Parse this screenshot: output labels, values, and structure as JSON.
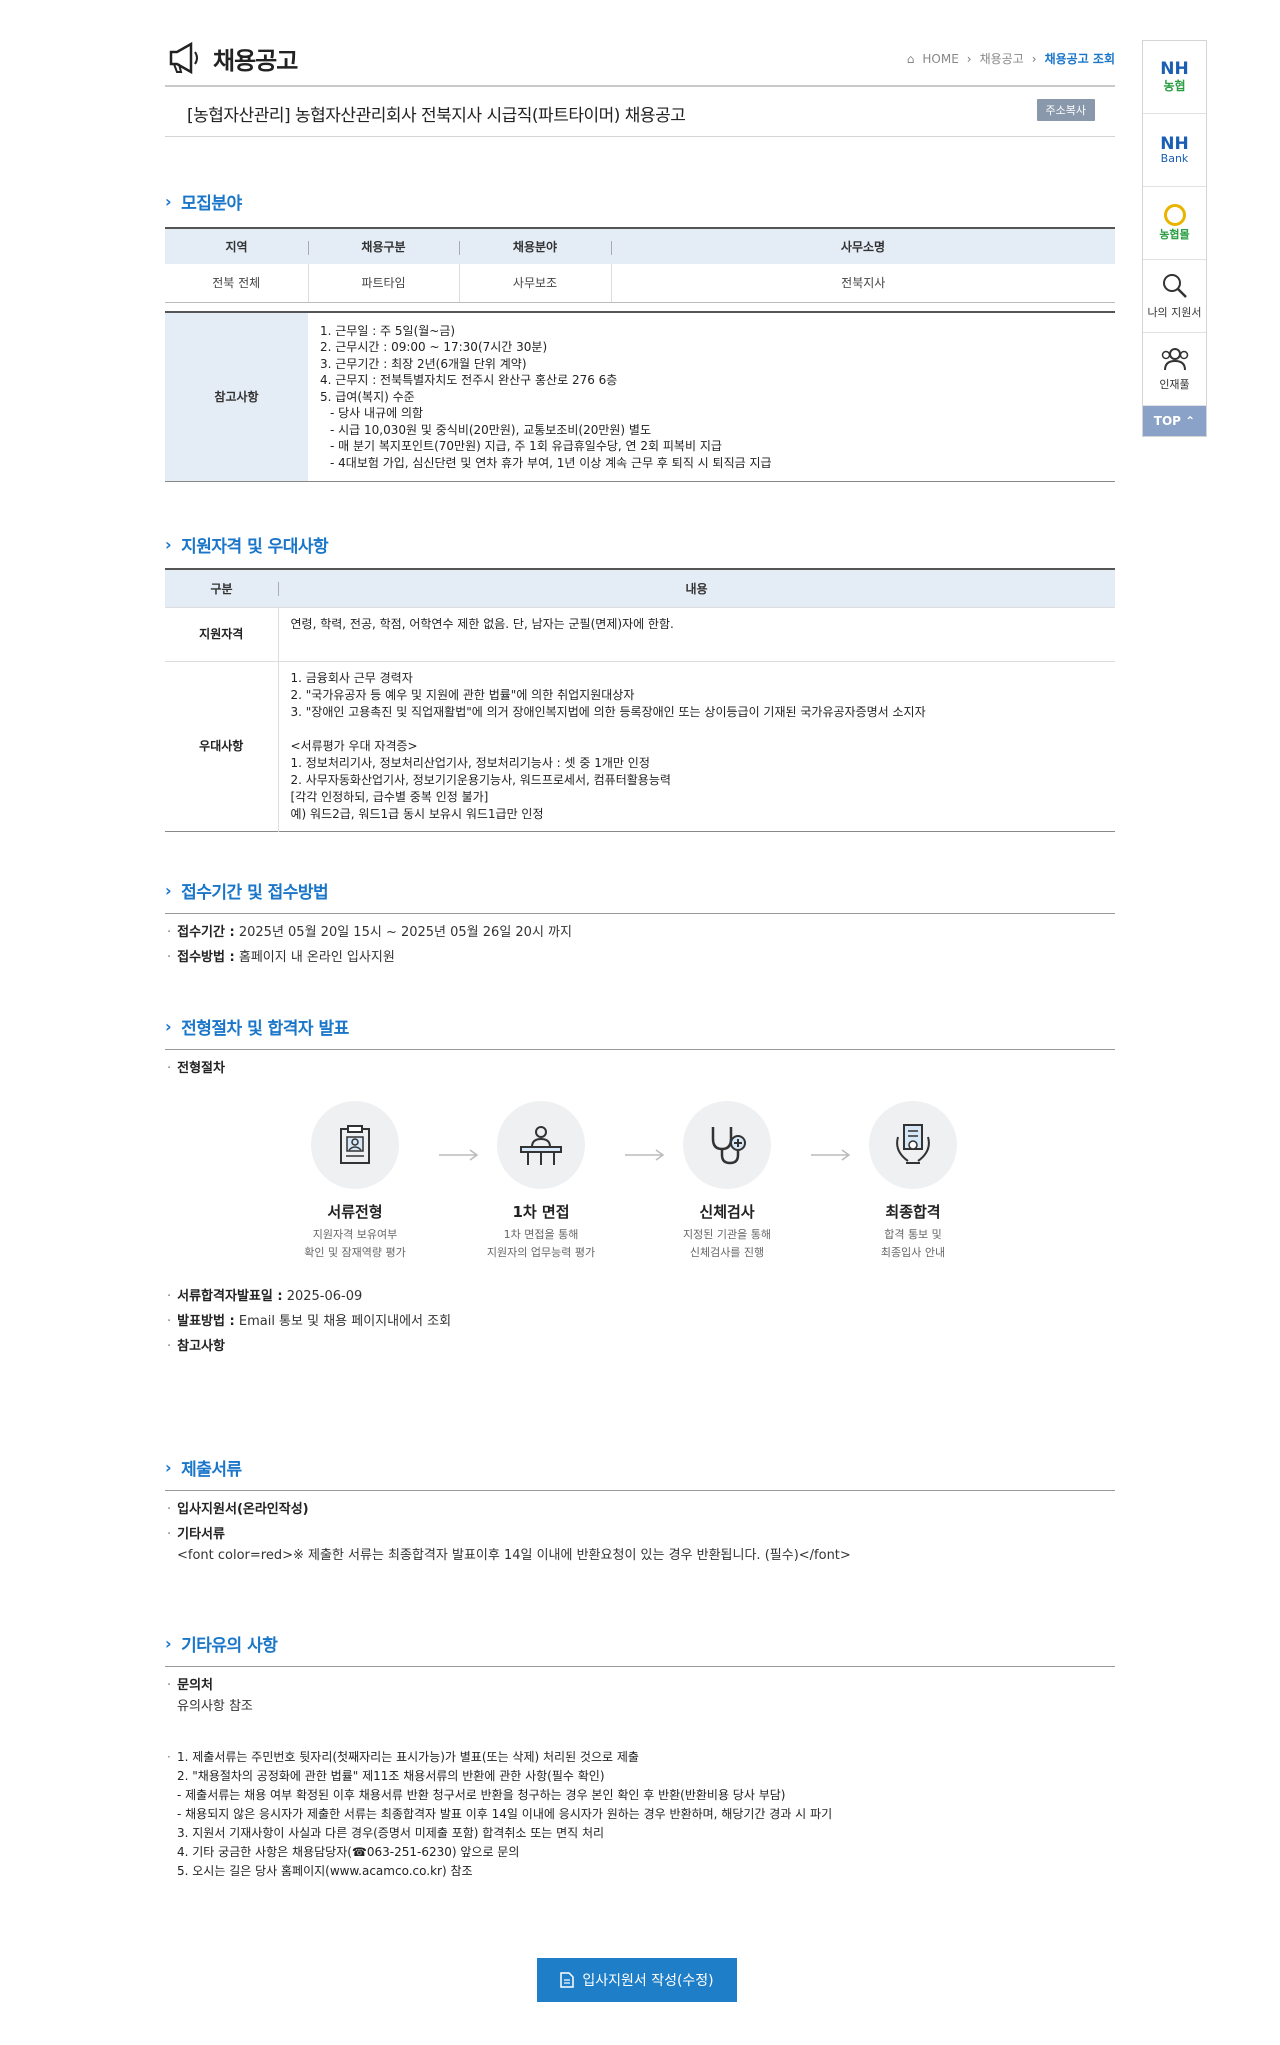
{
  "header": {
    "title": "채용공고",
    "breadcrumb": [
      "HOME",
      "채용공고",
      "채용공고 조회"
    ]
  },
  "post": {
    "title": "[농협자산관리] 농협자산관리회사 전북지사 시급직(파트타이머) 채용공고",
    "copy_label": "주소복사"
  },
  "recruit": {
    "heading": "모집분야",
    "columns": [
      "지역",
      "채용구분",
      "채용분야",
      "사무소명"
    ],
    "row": [
      "전북 전체",
      "파트타임",
      "사무보조",
      "전북지사"
    ],
    "note_label": "참고사항",
    "notes": [
      "1. 근무일 : 주 5일(월~금)",
      "2. 근무시간 : 09:00 ~ 17:30(7시간 30분)",
      "3. 근무기간 : 최장 2년(6개월 단위 계약)",
      "4. 근무지 : 전북특별자치도 전주시 완산구 홍산로 276 6층",
      "5. 급여(복지) 수준",
      "   - 당사 내규에 의함",
      "   - 시급 10,030원 및 중식비(20만원), 교통보조비(20만원) 별도",
      "   - 매 분기 복지포인트(70만원) 지급, 주 1회 유급휴일수당, 연 2회 피복비 지급",
      "   - 4대보험 가입, 심신단련 및 연차 휴가 부여, 1년 이상 계속 근무 후 퇴직 시 퇴직금 지급"
    ]
  },
  "qual": {
    "heading": "지원자격 및 우대사항",
    "columns": [
      "구분",
      "내용"
    ],
    "rows": [
      {
        "k": "지원자격",
        "v": [
          "연령, 학력, 전공, 학점, 어학연수 제한 없음. 단, 남자는 군필(면제)자에 한함."
        ]
      },
      {
        "k": "우대사항",
        "v": [
          "1. 금융회사 근무 경력자",
          "2. \"국가유공자 등 예우 및 지원에 관한 법률\"에 의한 취업지원대상자",
          "3. \"장애인 고용촉진 및 직업재활법\"에 의거 장애인복지법에 의한 등록장애인 또는 상이등급이 기재된 국가유공자증명서 소지자",
          "",
          "<서류평가 우대 자격증>",
          "1. 정보처리기사, 정보처리산업기사, 정보처리기능사 : 셋 중 1개만 인정",
          "2. 사무자동화산업기사, 정보기기운용기능사, 워드프로세서, 컴퓨터활용능력",
          "[각각 인정하되, 급수별 중복 인정 불가]",
          "예) 워드2급, 워드1급 동시 보유시 워드1급만 인정"
        ]
      }
    ]
  },
  "period": {
    "heading": "접수기간 및 접수방법",
    "items": [
      {
        "k": "접수기간 :",
        "v": "2025년 05월 20일 15시 ~ 2025년 05월 26일 20시 까지"
      },
      {
        "k": "접수방법 :",
        "v": "홈페이지 내 온라인 입사지원"
      }
    ]
  },
  "process": {
    "heading": "전형절차 및 합격자 발표",
    "sub": "전형절차",
    "steps": [
      {
        "t": "서류전형",
        "d1": "지원자격 보유여부",
        "d2": "확인 및 잠재역량 평가"
      },
      {
        "t": "1차 면접",
        "d1": "1차 면접을 통해",
        "d2": "지원자의 업무능력 평가"
      },
      {
        "t": "신체검사",
        "d1": "지정된 기관을 통해",
        "d2": "신체검사를 진행"
      },
      {
        "t": "최종합격",
        "d1": "합격 통보 및",
        "d2": "최종입사 안내"
      }
    ],
    "items": [
      {
        "k": "서류합격자발표일 :",
        "v": "2025-06-09"
      },
      {
        "k": "발표방법 :",
        "v": "Email 통보 및 채용 페이지내에서 조회"
      },
      {
        "k": "참고사항",
        "v": ""
      }
    ]
  },
  "docs": {
    "heading": "제출서류",
    "i1": "입사지원서(온라인작성)",
    "i2": "기타서류",
    "i2v": "<font color=red>※ 제출한 서류는 최종합격자 발표이후 14일 이내에 반환요청이 있는 경우 반환됩니다. (필수)</font>"
  },
  "etc": {
    "heading": "기타유의 사항",
    "k": "문의처",
    "v": "유의사항 참조",
    "lines": [
      "1. 제출서류는 주민번호 뒷자리(첫째자리는 표시가능)가 별표(또는 삭제) 처리된 것으로 제출",
      "2. \"채용절차의 공정화에 관한 법률\" 제11조 채용서류의 반환에 관한 사항(필수 확인)",
      " - 제출서류는 채용 여부 확정된 이후 채용서류 반환 청구서로 반환을 청구하는 경우 본인 확인 후 반환(반환비용 당사 부담)",
      " - 채용되지 않은 응시자가 제출한 서류는 최종합격자 발표 이후 14일 이내에 응시자가 원하는 경우 반환하며, 해당기간 경과 시 파기",
      "3. 지원서 기재사항이 사실과 다른 경우(증명서 미제출 포함) 합격취소 또는 면직 처리",
      "4. 기타 궁금한 사항은 채용담당자(☎063-251-6230) 앞으로 문의",
      "5. 오시는 길은 당사 홈페이지(www.acamco.co.kr) 참조"
    ]
  },
  "apply_label": "입사지원서 작성(수정)",
  "side": {
    "nh1": "NH",
    "nh1b": "농협",
    "nh2": "NH",
    "nh2b": "Bank",
    "mall": "농협몰",
    "my": "나의 지원서",
    "people": "인재풀",
    "top": "TOP"
  },
  "colors": {
    "accent": "#1a76c9",
    "header_bg": "#e4ecf5",
    "button": "#1f7ec8"
  }
}
